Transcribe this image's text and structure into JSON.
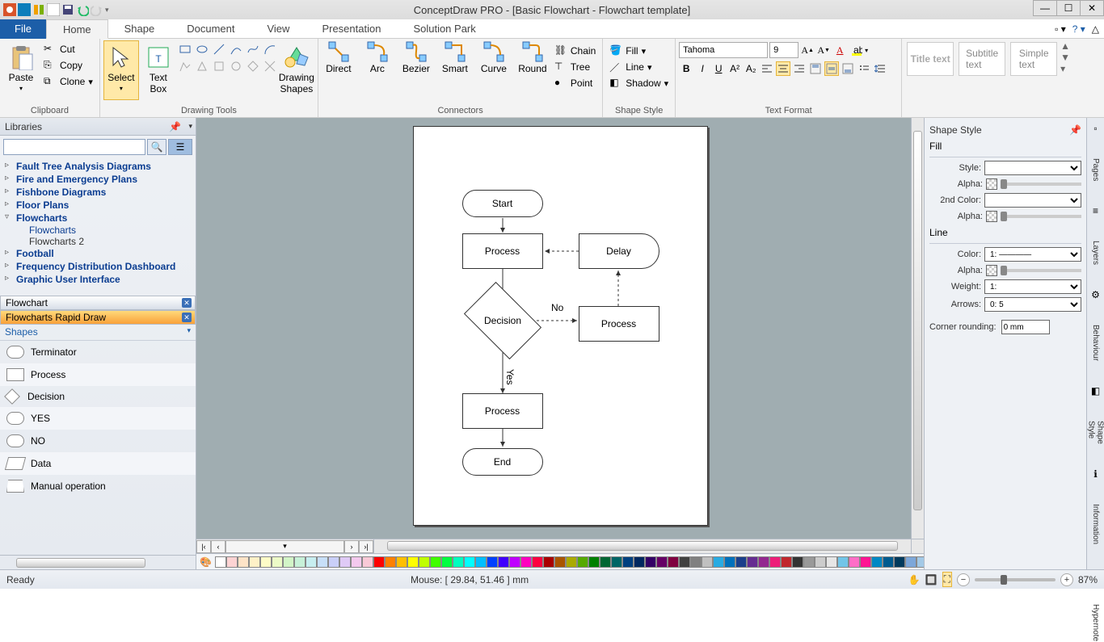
{
  "title": "ConceptDraw PRO - [Basic Flowchart - Flowchart template]",
  "menubar": {
    "file": "File",
    "tabs": [
      "Home",
      "Shape",
      "Document",
      "View",
      "Presentation",
      "Solution Park"
    ],
    "active": "Home"
  },
  "ribbon": {
    "clipboard": {
      "paste": "Paste",
      "cut": "Cut",
      "copy": "Copy",
      "clone": "Clone",
      "label": "Clipboard"
    },
    "tools": {
      "select": "Select",
      "textbox": "Text\nBox",
      "label": "Drawing Tools"
    },
    "shapes": {
      "drawing": "Drawing\nShapes"
    },
    "connectors": {
      "items": [
        "Direct",
        "Arc",
        "Bezier",
        "Smart",
        "Curve",
        "Round"
      ],
      "chain": "Chain",
      "tree": "Tree",
      "point": "Point",
      "label": "Connectors"
    },
    "shapestyle": {
      "fill": "Fill",
      "line": "Line",
      "shadow": "Shadow",
      "label": "Shape Style"
    },
    "textformat": {
      "font": "Tahoma",
      "size": "9",
      "label": "Text Format"
    },
    "styles": [
      "Title\ntext",
      "Subtitle\ntext",
      "Simple\ntext"
    ]
  },
  "libraries": {
    "title": "Libraries",
    "tree": [
      "Fault Tree Analysis Diagrams",
      "Fire and Emergency Plans",
      "Fishbone Diagrams",
      "Floor Plans",
      "Flowcharts",
      "Football",
      "Frequency Distribution Dashboard",
      "Graphic User Interface"
    ],
    "subs": [
      "Flowcharts",
      "Flowcharts 2"
    ],
    "tabs": [
      {
        "name": "Flowchart"
      },
      {
        "name": "Flowcharts Rapid Draw"
      }
    ],
    "shapes_head": "Shapes",
    "shapes": [
      "Terminator",
      "Process",
      "Decision",
      "YES",
      "NO",
      "Data",
      "Manual operation"
    ]
  },
  "canvas": {
    "shapes": {
      "start": "Start",
      "process": "Process",
      "delay": "Delay",
      "decision": "Decision",
      "end": "End"
    },
    "labels": {
      "no": "No",
      "yes": "Yes"
    }
  },
  "colors": [
    "#ffffff",
    "#fdd3d3",
    "#fde3c7",
    "#fef1c7",
    "#fdfcc7",
    "#ecfac7",
    "#d2f5c7",
    "#c7f1d8",
    "#c7eef0",
    "#c7dff8",
    "#c9cff8",
    "#dfcaf6",
    "#f4c9ee",
    "#f8c9d7",
    "#ff0000",
    "#ff8000",
    "#ffbf00",
    "#ffff00",
    "#bfff00",
    "#40ff00",
    "#00ff40",
    "#00ffbf",
    "#00ffff",
    "#00bfff",
    "#0040ff",
    "#4000ff",
    "#bf00ff",
    "#ff00bf",
    "#ff0040",
    "#aa0000",
    "#aa5500",
    "#aaaa00",
    "#55aa00",
    "#008000",
    "#006633",
    "#006666",
    "#004080",
    "#002860",
    "#330066",
    "#660066",
    "#800040",
    "#404040",
    "#808080",
    "#c0c0c0",
    "#29abe2",
    "#0071bc",
    "#1b3f8b",
    "#662d91",
    "#93278f",
    "#ed1e79",
    "#c1272d",
    "#333333",
    "#999999",
    "#cccccc",
    "#e6e6e6",
    "#71c5e8",
    "#ff6ec7",
    "#ff1493",
    "#0088c4",
    "#005b8f",
    "#003a5d",
    "#7da7d9",
    "#a3c9e6",
    "#dbedf9"
  ],
  "right": {
    "title": "Shape Style",
    "fill": "Fill",
    "style": "Style:",
    "alpha": "Alpha:",
    "second": "2nd Color:",
    "line": "Line",
    "color": "Color:",
    "weight": "Weight:",
    "weight_val": "1:",
    "arrows": "Arrows:",
    "arrows_val": "0:                    5",
    "corner": "Corner rounding:",
    "corner_val": "0 mm",
    "tabs": [
      "Pages",
      "Layers",
      "Behaviour",
      "Shape Style",
      "Information",
      "Hypernote"
    ]
  },
  "status": {
    "ready": "Ready",
    "mouse": "Mouse: [ 29.84, 51.46 ] mm",
    "zoom": "87%"
  }
}
